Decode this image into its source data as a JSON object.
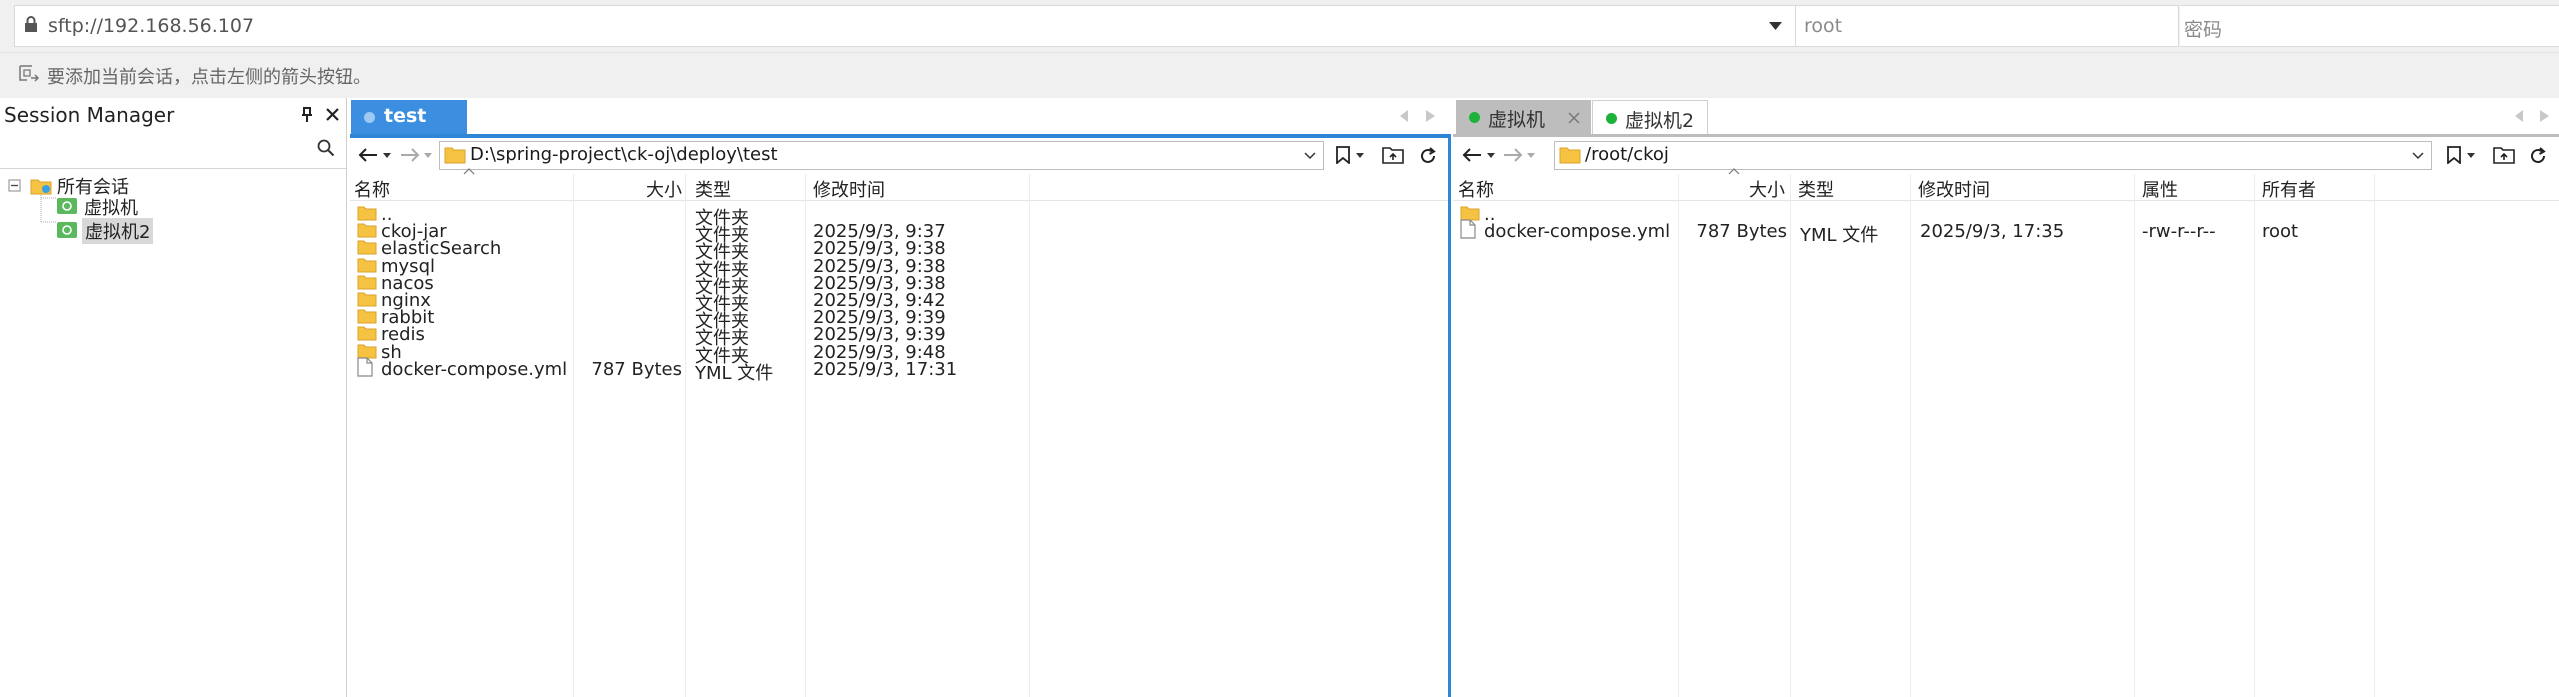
{
  "address": {
    "url": "sftp://192.168.56.107",
    "user_placeholder": "root",
    "password_placeholder": "密码"
  },
  "hint": "要添加当前会话，点击左侧的箭头按钮。",
  "session_manager": {
    "title": "Session Manager",
    "root_label": "所有会话",
    "items": [
      "虚拟机",
      "虚拟机2"
    ],
    "selected_index": 1
  },
  "left_tabs": [
    {
      "label": "test",
      "active": true
    }
  ],
  "right_tabs": [
    {
      "label": "虚拟机",
      "active": false,
      "status_color": "#1db33a"
    },
    {
      "label": "虚拟机2",
      "active": true,
      "status_color": "#1db33a"
    }
  ],
  "local": {
    "path": "D:\\spring-project\\ck-oj\\deploy\\test",
    "columns": {
      "name": "名称",
      "size": "大小",
      "type": "类型",
      "modified": "修改时间"
    },
    "files": [
      {
        "name": "..",
        "size": "",
        "type": "文件夹",
        "modified": "",
        "kind": "folder"
      },
      {
        "name": "ckoj-jar",
        "size": "",
        "type": "文件夹",
        "modified": "2025/9/3, 9:37",
        "kind": "folder"
      },
      {
        "name": "elasticSearch",
        "size": "",
        "type": "文件夹",
        "modified": "2025/9/3, 9:38",
        "kind": "folder"
      },
      {
        "name": "mysql",
        "size": "",
        "type": "文件夹",
        "modified": "2025/9/3, 9:38",
        "kind": "folder"
      },
      {
        "name": "nacos",
        "size": "",
        "type": "文件夹",
        "modified": "2025/9/3, 9:38",
        "kind": "folder"
      },
      {
        "name": "nginx",
        "size": "",
        "type": "文件夹",
        "modified": "2025/9/3, 9:42",
        "kind": "folder"
      },
      {
        "name": "rabbit",
        "size": "",
        "type": "文件夹",
        "modified": "2025/9/3, 9:39",
        "kind": "folder"
      },
      {
        "name": "redis",
        "size": "",
        "type": "文件夹",
        "modified": "2025/9/3, 9:39",
        "kind": "folder"
      },
      {
        "name": "sh",
        "size": "",
        "type": "文件夹",
        "modified": "2025/9/3, 9:48",
        "kind": "folder"
      },
      {
        "name": "docker-compose.yml",
        "size": "787 Bytes",
        "type": "YML 文件",
        "modified": "2025/9/3, 17:31",
        "kind": "file"
      }
    ]
  },
  "remote": {
    "path": "/root/ckoj",
    "columns": {
      "name": "名称",
      "size": "大小",
      "type": "类型",
      "modified": "修改时间",
      "attr": "属性",
      "owner": "所有者"
    },
    "files": [
      {
        "name": "..",
        "size": "",
        "type": "",
        "modified": "",
        "attr": "",
        "owner": "",
        "kind": "folder"
      },
      {
        "name": "docker-compose.yml",
        "size": "787 Bytes",
        "type": "YML 文件",
        "modified": "2025/9/3, 17:35",
        "attr": "-rw-r--r--",
        "owner": "root",
        "kind": "file"
      }
    ]
  },
  "colors": {
    "accent": "#2f86d6",
    "tab_active": "#3c8fe0",
    "folder": "#f5c242",
    "status": "#1db33a"
  }
}
